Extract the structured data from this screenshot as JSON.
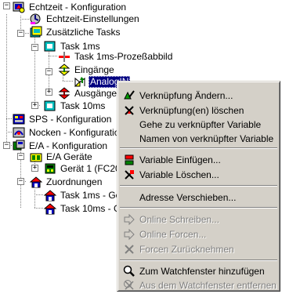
{
  "tree": {
    "echtzeit": "Echtzeit - Konfiguration",
    "echtzeit_einstellungen": "Echtzeit-Einstellungen",
    "zusaetzliche_tasks": "Zusätzliche Tasks",
    "task_1ms": "Task 1ms",
    "task_1ms_prozessabbild": "Task 1ms-Prozeßabbild",
    "eingaenge": "Eingänge",
    "analog": "AnalogIN",
    "ausgaenge": "Ausgänge",
    "task_10ms": "Task 10ms",
    "sps": "SPS - Konfiguration",
    "nocken": "Nocken - Konfiguration",
    "ea": "E/A - Konfiguration",
    "ea_geraete": "E/A Geräte",
    "geraet1": "Gerät 1 (FC200",
    "zuordnungen": "Zuordnungen",
    "map1": "Task 1ms - Ger",
    "map2": "Task 10ms - Ge"
  },
  "menu": {
    "verknuepfung_aendern": "Verknüpfung Ändern...",
    "verknuepfung_loeschen": "Verknüpfung(en) löschen",
    "gehe_zu": "Gehe zu verknüpfter Variable",
    "namen_von": "Namen von verknüpfter Variable",
    "variable_einfuegen": "Variable Einfügen...",
    "variable_loeschen": "Variable Löschen...",
    "adresse_verschieben": "Adresse Verschieben...",
    "online_schreiben": "Online Schreiben...",
    "online_forcen": "Online Forcen...",
    "forcen_zuruecknehmen": "Forcen Zurücknehmen",
    "watch_hinzufuegen": "Zum Watchfenster hinzufügen",
    "watch_entfernen": "Aus dem Watchfenster entfernen"
  },
  "colors": {
    "selection": "#000080",
    "menu_bg": "#d4d0c8",
    "disabled_text": "#808080"
  }
}
